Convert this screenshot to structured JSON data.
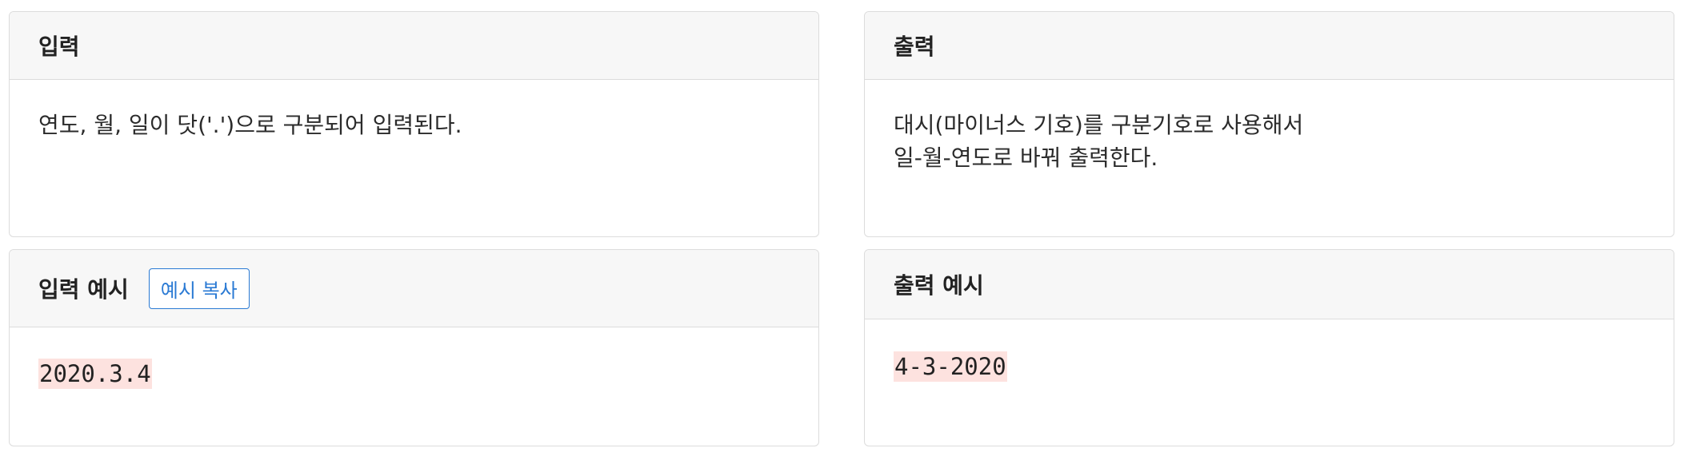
{
  "input_section": {
    "title": "입력",
    "text": "연도, 월, 일이 닷('.')으로 구분되어 입력된다."
  },
  "output_section": {
    "title": "출력",
    "text": "대시(마이너스 기호)를 구분기호로 사용해서\n일-월-연도로 바꿔 출력한다."
  },
  "input_example": {
    "title": "입력 예시",
    "copy_button_label": "예시 복사",
    "value": "2020.3.4"
  },
  "output_example": {
    "title": "출력 예시",
    "value": "4-3-2020"
  },
  "colors": {
    "header_bg": "#f7f7f7",
    "border": "#dcdcdc",
    "accent_blue": "#2a7ad4",
    "code_bg": "#fde2df"
  }
}
